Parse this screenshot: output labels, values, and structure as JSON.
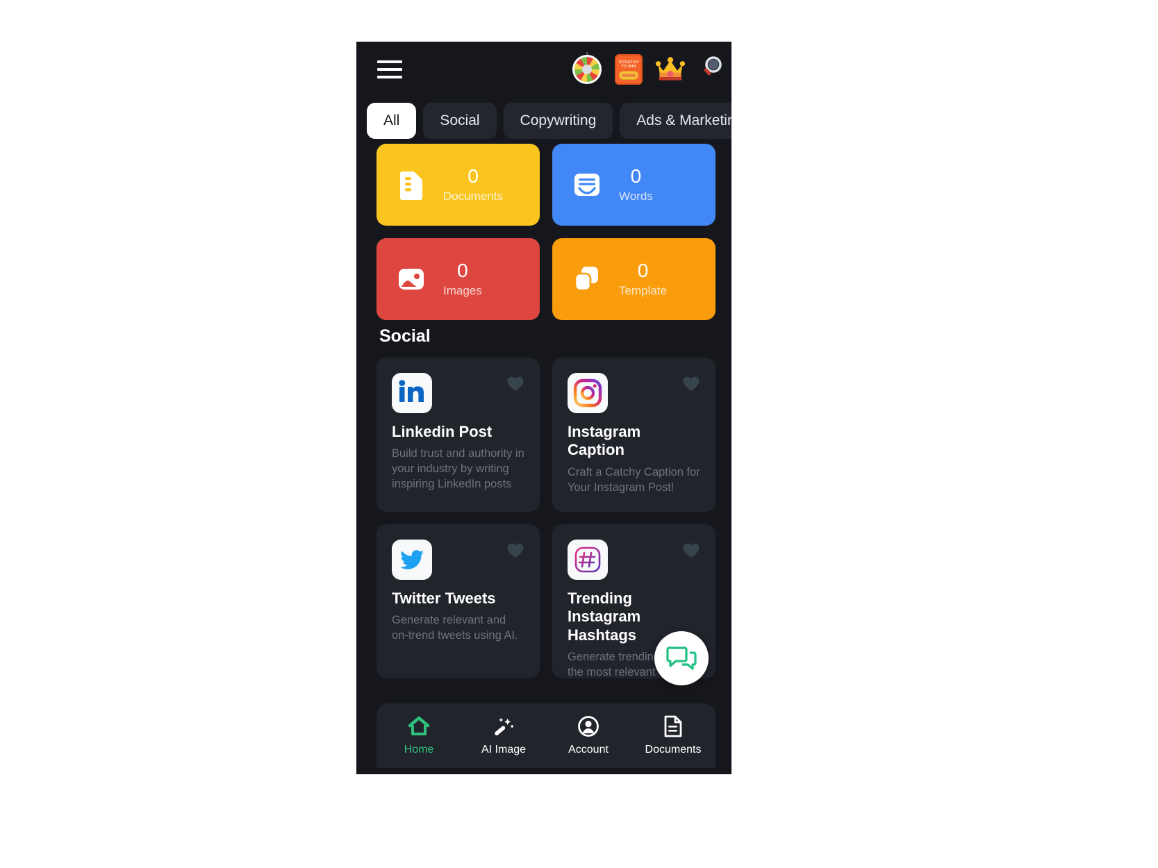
{
  "app": {
    "background": "#16171c",
    "card_background": "#22242c",
    "accent": "#2ec27e"
  },
  "topbar": {
    "menu_icon": "hamburger-menu-icon",
    "icons": [
      {
        "name": "spin-wheel-icon",
        "label": "Spin Wheel"
      },
      {
        "name": "scratch-to-win-icon",
        "label": "SCRATCH TO WIN",
        "line1": "SCRATCH",
        "line2": "TO WIN"
      },
      {
        "name": "crown-premium-icon",
        "label": "Premium"
      },
      {
        "name": "search-icon",
        "label": "Search"
      }
    ]
  },
  "tabs": [
    {
      "label": "All",
      "active": true
    },
    {
      "label": "Social",
      "active": false
    },
    {
      "label": "Copywriting",
      "active": false
    },
    {
      "label": "Ads & Marketing",
      "active": false
    }
  ],
  "stats": [
    {
      "value": "0",
      "label": "Documents",
      "color": "#fbc520",
      "icon": "document-icon"
    },
    {
      "value": "0",
      "label": "Words",
      "color": "#4187f5",
      "icon": "words-card-icon"
    },
    {
      "value": "0",
      "label": "Images",
      "color": "#de4740",
      "icon": "image-icon"
    },
    {
      "value": "0",
      "label": "Template",
      "color": "#f99d0c",
      "icon": "template-copy-icon"
    }
  ],
  "sections": {
    "social_title": "Social"
  },
  "templates": [
    {
      "title": "Linkedin Post",
      "description": "Build trust and authority in your industry by writing inspiring LinkedIn posts",
      "logo": "linkedin-logo-icon",
      "favorite_icon": "heart-icon"
    },
    {
      "title": "Instagram Caption",
      "description": "Craft a Catchy Caption for Your Instagram Post!",
      "logo": "instagram-logo-icon",
      "favorite_icon": "heart-icon"
    },
    {
      "title": "Twitter Tweets",
      "description": "Generate relevant and on-trend tweets using AI.",
      "logo": "twitter-logo-icon",
      "favorite_icon": "heart-icon"
    },
    {
      "title": "Trending Instagram Hashtags",
      "description": "Generate trending and the most relevant Instagram post hashtags",
      "logo": "hashtag-logo-icon",
      "favorite_icon": "heart-icon"
    }
  ],
  "fab": {
    "name": "chat-support-button",
    "icon": "chat-bubble-icon"
  },
  "bottom_nav": [
    {
      "label": "Home",
      "icon": "home-icon",
      "active": true
    },
    {
      "label": "AI Image",
      "icon": "magic-wand-icon",
      "active": false
    },
    {
      "label": "Account",
      "icon": "account-icon",
      "active": false
    },
    {
      "label": "Documents",
      "icon": "documents-icon",
      "active": false
    }
  ]
}
